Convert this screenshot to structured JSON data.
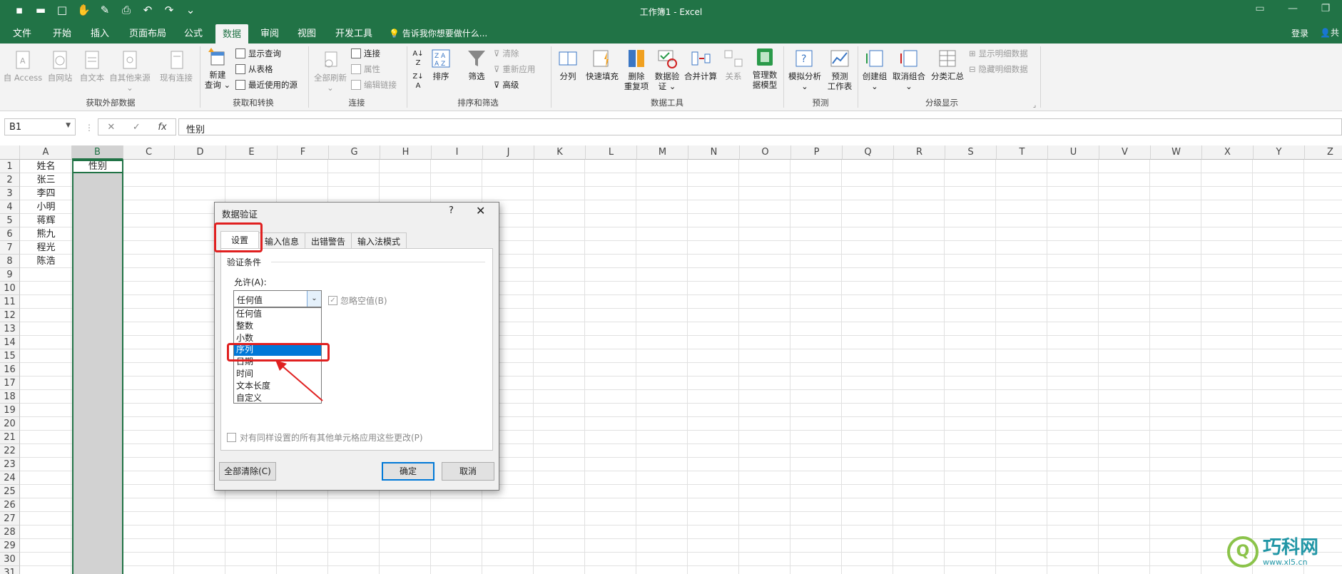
{
  "window": {
    "title": "工作簿1 - Excel"
  },
  "qat_icons": [
    "save-icon",
    "open-icon",
    "new-icon",
    "touch-mode-icon",
    "format-painter-icon",
    "print-preview-icon",
    "undo-icon",
    "redo-icon",
    "customize-icon"
  ],
  "menu": {
    "tabs": [
      "文件",
      "开始",
      "插入",
      "页面布局",
      "公式",
      "数据",
      "审阅",
      "视图",
      "开发工具"
    ],
    "active": "数据",
    "tell_me": "告诉我你想要做什么...",
    "login": "登录",
    "share": "共"
  },
  "ribbon": {
    "ext_data": {
      "access": "自 Access",
      "web": "自网站",
      "text": "自文本",
      "other_line1": "自其他来源",
      "existing": "现有连接",
      "group": "获取外部数据"
    },
    "get_transform": {
      "new_query_1": "新建",
      "new_query_2": "查询",
      "show_queries": "显示查询",
      "from_table": "从表格",
      "recent_sources": "最近使用的源",
      "group": "获取和转换"
    },
    "connections": {
      "refresh_all": "全部刷新",
      "connections": "连接",
      "properties": "属性",
      "edit_links": "编辑链接",
      "group": "连接"
    },
    "sort_filter": {
      "sort": "排序",
      "filter": "筛选",
      "clear": "清除",
      "reapply": "重新应用",
      "advanced": "高级",
      "group": "排序和筛选"
    },
    "data_tools": {
      "split": "分列",
      "flash_fill": "快速填充",
      "remove_dup_1": "删除",
      "remove_dup_2": "重复项",
      "validation_1": "数据验",
      "validation_2": "证",
      "consolidate": "合并计算",
      "relations": "关系",
      "data_model_1": "管理数",
      "data_model_2": "据模型",
      "group": "数据工具"
    },
    "forecast": {
      "what_if": "模拟分析",
      "forecast_1": "预测",
      "forecast_2": "工作表",
      "group": "预测"
    },
    "outline": {
      "group_btn": "创建组",
      "ungroup": "取消组合",
      "subtotal": "分类汇总",
      "show_detail": "显示明细数据",
      "hide_detail": "隐藏明细数据",
      "group": "分级显示"
    }
  },
  "formula_bar": {
    "name_box": "B1",
    "cancel": "✕",
    "enter": "✓",
    "fx": "fx",
    "content": "性别"
  },
  "sheet": {
    "columns": [
      "A",
      "B",
      "C",
      "D",
      "E",
      "F",
      "G",
      "H",
      "I",
      "J",
      "K",
      "L",
      "M",
      "N",
      "O",
      "P",
      "Q",
      "R",
      "S",
      "T",
      "U",
      "V",
      "W",
      "X",
      "Y",
      "Z"
    ],
    "rows": [
      "1",
      "2",
      "3",
      "4",
      "5",
      "6",
      "7",
      "8",
      "9",
      "10",
      "11",
      "12",
      "13",
      "14",
      "15",
      "16",
      "17",
      "18",
      "19",
      "20",
      "21",
      "22",
      "23",
      "24",
      "25",
      "26",
      "27",
      "28",
      "29",
      "30",
      "31"
    ],
    "col_a": [
      "姓名",
      "张三",
      "李四",
      "小明",
      "蒋辉",
      "熊九",
      "程光",
      "陈浩"
    ],
    "b1": "性别",
    "selected_column": "B"
  },
  "dialog": {
    "title": "数据验证",
    "help": "?",
    "close": "✕",
    "tabs": [
      "设置",
      "输入信息",
      "出错警告",
      "输入法模式"
    ],
    "section": "验证条件",
    "allow_label": "允许(A):",
    "allow_value": "任何值",
    "ignore_blank": "忽略空值(B)",
    "options": [
      "任何值",
      "整数",
      "小数",
      "序列",
      "日期",
      "时间",
      "文本长度",
      "自定义"
    ],
    "highlighted_option": "序列",
    "apply_all": "对有同样设置的所有其他单元格应用这些更改(P)",
    "clear_all": "全部清除(C)",
    "ok": "确定",
    "cancel": "取消"
  },
  "watermark": {
    "logo": "Q",
    "name": "巧科网",
    "url": "www.xl5.cn"
  },
  "colors": {
    "excel_green": "#217346",
    "ribbon_bg": "#f3f3f3",
    "highlight_blue": "#0078d7",
    "annotation_red": "#e02020"
  }
}
